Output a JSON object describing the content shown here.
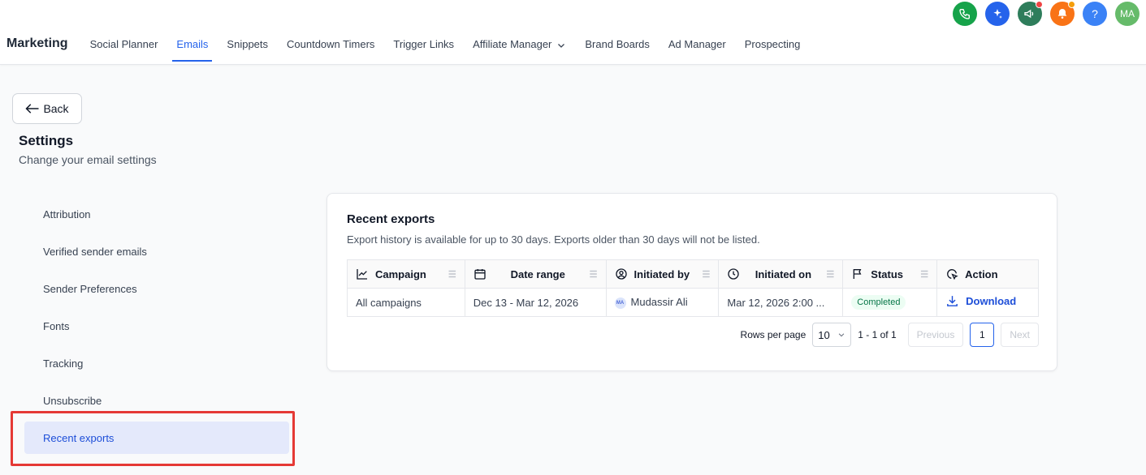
{
  "top_icons": [
    {
      "name": "phone-icon",
      "color": "#16a34a"
    },
    {
      "name": "sparkles-icon",
      "color": "#2563eb"
    },
    {
      "name": "megaphone-icon",
      "color": "#2e7d5b",
      "badge": "#ef4444"
    },
    {
      "name": "bell-icon",
      "color": "#f97316",
      "badge": "#f59e0b"
    },
    {
      "name": "help-icon",
      "color": "#3b82f6",
      "label": "?"
    },
    {
      "name": "avatar",
      "color": "#66bb6a",
      "label": "MA"
    }
  ],
  "nav": {
    "title": "Marketing",
    "items": [
      "Social Planner",
      "Emails",
      "Snippets",
      "Countdown Timers",
      "Trigger Links",
      "Affiliate Manager",
      "Brand Boards",
      "Ad Manager",
      "Prospecting"
    ],
    "active": "Emails"
  },
  "back_label": "Back",
  "settings": {
    "title": "Settings",
    "subtitle": "Change your email settings"
  },
  "side_menu": [
    "Attribution",
    "Verified sender emails",
    "Sender Preferences",
    "Fonts",
    "Tracking",
    "Unsubscribe",
    "Recent exports"
  ],
  "side_active": "Recent exports",
  "card": {
    "title": "Recent exports",
    "subtitle": "Export history is available for up to 30 days. Exports older than 30 days will not be listed."
  },
  "table": {
    "headers": [
      "Campaign",
      "Date range",
      "Initiated by",
      "Initiated on",
      "Status",
      "Action"
    ],
    "rows": [
      {
        "campaign": "All campaigns",
        "date_range": "Dec 13 - Mar 12, 2026",
        "initiated_by_initials": "MA",
        "initiated_by": "Mudassir Ali",
        "initiated_on": "Mar 12, 2026 2:00 ...",
        "status": "Completed",
        "action": "Download"
      }
    ]
  },
  "pager": {
    "rows_label": "Rows per page",
    "rows_value": "10",
    "range": "1 - 1 of 1",
    "prev": "Previous",
    "page": "1",
    "next": "Next"
  }
}
